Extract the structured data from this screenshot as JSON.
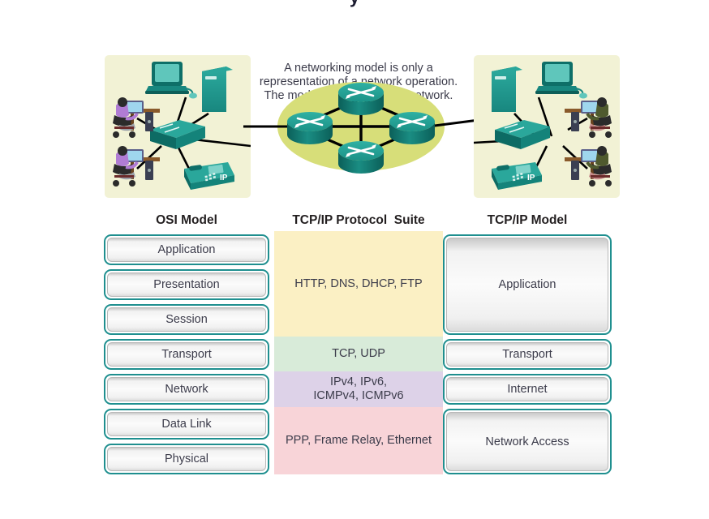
{
  "cut_title": "y",
  "illustration": {
    "caption_lines": [
      "A networking model is only a",
      "representation of a network operation.",
      "The model is not the actual network."
    ],
    "panel_left_name": "left-network-panel",
    "panel_right_name": "right-network-panel",
    "phone_label": "IP",
    "router_count": 4,
    "colors": {
      "panel_bg": "#f2f2d5",
      "cloud": "#d7de79",
      "device_teal": "#18877f",
      "device_teal_dark": "#0c5f5a",
      "link": "#000000"
    }
  },
  "headers": {
    "osi": "OSI Model",
    "suite": "TCP/IP Protocol  Suite",
    "tcpip": "TCP/IP Model"
  },
  "osi_layers": [
    {
      "label": "Application"
    },
    {
      "label": "Presentation"
    },
    {
      "label": "Session"
    },
    {
      "label": "Transport"
    },
    {
      "label": "Network"
    },
    {
      "label": "Data Link"
    },
    {
      "label": "Physical"
    }
  ],
  "protocol_bands": [
    {
      "label": "HTTP, DNS, DHCP, FTP",
      "color": "#fbf0c4"
    },
    {
      "label": "TCP, UDP",
      "color": "#d8ebd9"
    },
    {
      "label": "IPv4, IPv6,\nICMPv4, ICMPv6",
      "color": "#ddd2e8"
    },
    {
      "label": "PPP, Frame Relay, Ethernet",
      "color": "#f8d4d8"
    }
  ],
  "tcpip_layers": [
    {
      "label": "Application"
    },
    {
      "label": "Transport"
    },
    {
      "label": "Internet"
    },
    {
      "label": "Network Access"
    }
  ],
  "accent_colors": {
    "box_border": "#1f8f8f",
    "text": "#3b3b4a",
    "header_text": "#231f20"
  }
}
